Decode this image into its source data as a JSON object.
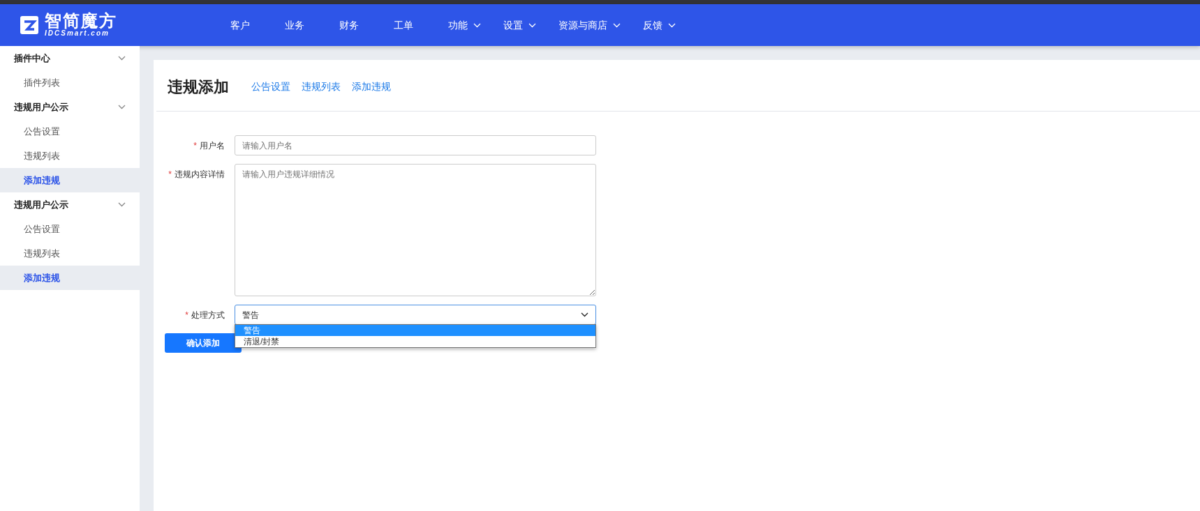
{
  "logo": {
    "title": "智简魔方",
    "subtitle": "IDCSmart.com"
  },
  "nav": [
    {
      "label": "客户",
      "has_menu": false
    },
    {
      "label": "业务",
      "has_menu": false
    },
    {
      "label": "财务",
      "has_menu": false
    },
    {
      "label": "工单",
      "has_menu": false
    },
    {
      "label": "功能",
      "has_menu": true
    },
    {
      "label": "设置",
      "has_menu": true
    },
    {
      "label": "资源与商店",
      "has_menu": true
    },
    {
      "label": "反馈",
      "has_menu": true
    }
  ],
  "sidebar": {
    "groups": [
      {
        "label": "插件中心",
        "expanded": true,
        "children": [
          {
            "label": "插件列表",
            "selected": false
          }
        ]
      },
      {
        "label": "违规用户公示",
        "expanded": true,
        "children": [
          {
            "label": "公告设置",
            "selected": false
          },
          {
            "label": "违规列表",
            "selected": false
          },
          {
            "label": "添加违规",
            "selected": true
          }
        ]
      },
      {
        "label": "违规用户公示",
        "expanded": true,
        "children": [
          {
            "label": "公告设置",
            "selected": false
          },
          {
            "label": "违规列表",
            "selected": false
          },
          {
            "label": "添加违规",
            "selected": true
          }
        ]
      }
    ]
  },
  "page": {
    "title": "违规添加",
    "links": [
      "公告设置",
      "违规列表",
      "添加违规"
    ]
  },
  "form": {
    "fields": [
      {
        "kind": "input",
        "label": "用户名",
        "required_mark": "*",
        "placeholder": "请输入用户名"
      },
      {
        "kind": "textarea",
        "label": "违规内容详情",
        "required_mark": "*",
        "placeholder": "请输入用户违规详细情况"
      },
      {
        "kind": "select",
        "label": "处理方式",
        "required_mark": "*",
        "value": "警告",
        "expanded": true,
        "options": [
          {
            "label": "警告",
            "selected": true
          },
          {
            "label": "清退/封禁",
            "selected": false
          }
        ]
      }
    ],
    "submit": "确认添加"
  }
}
